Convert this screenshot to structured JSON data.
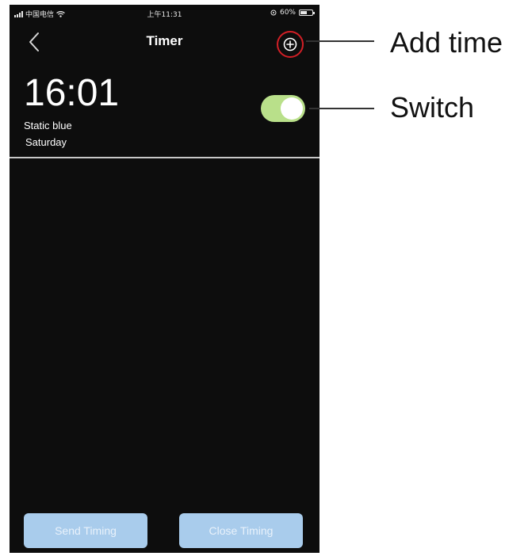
{
  "status_bar": {
    "carrier": "中国电信",
    "time": "上午11:31",
    "battery": "60%",
    "battery_level": 0.6
  },
  "nav": {
    "title": "Timer"
  },
  "timers": [
    {
      "time": "16:01",
      "mode": "Static blue",
      "day": "Saturday",
      "enabled": true
    }
  ],
  "buttons": {
    "send": "Send Timing",
    "close": "Close Timing"
  },
  "annotations": {
    "add_time": "Add time",
    "switch": "Switch"
  },
  "colors": {
    "background": "#0d0d0d",
    "toggle_on": "#b9e08a",
    "button": "#a9ccec",
    "highlight_ring": "#d21f26"
  },
  "icons": {
    "back": "chevron-left-icon",
    "add": "plus-circle-icon",
    "wifi": "wifi-icon",
    "battery": "battery-icon"
  }
}
